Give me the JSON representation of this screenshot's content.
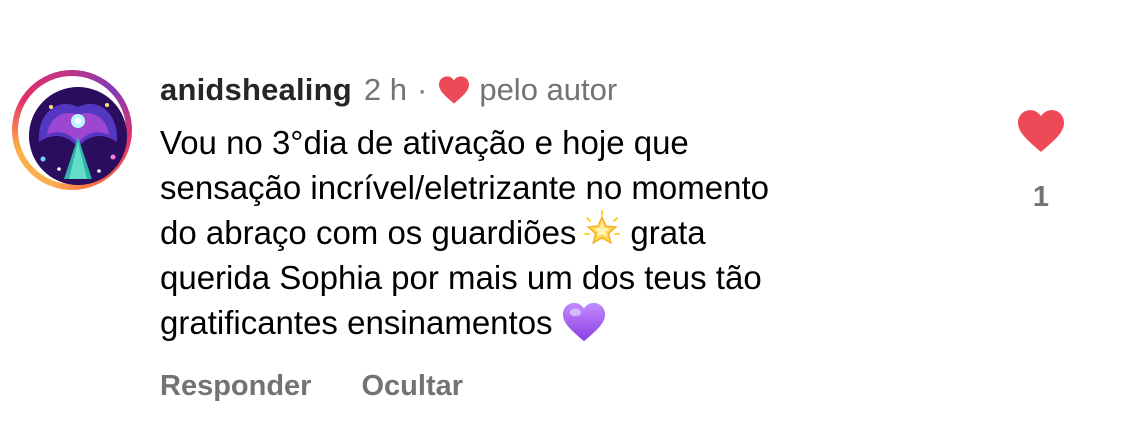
{
  "comment": {
    "username": "anidshealing",
    "time_ago": "2 h",
    "separator": "·",
    "author_tag": "pelo autor",
    "body_lines": [
      "Vou no 3°dia de ativação e hoje que",
      "sensação incrível/eletrizante no momento",
      "do abraço com os guardiões",
      "grata",
      "querida Sophia por mais um dos teus tão",
      "gratificantes ensinamentos"
    ],
    "emojis": {
      "star": "glowing-star",
      "heart": "purple-heart"
    },
    "like_count": "1",
    "liked_by_author": true
  },
  "actions": {
    "reply_label": "Responder",
    "hide_label": "Ocultar"
  },
  "colors": {
    "heart_red": "#ed4956",
    "secondary_text": "#737373",
    "username_text": "#262626",
    "purple_heart": "#a259e6",
    "star_yellow": "#ffcf33"
  }
}
